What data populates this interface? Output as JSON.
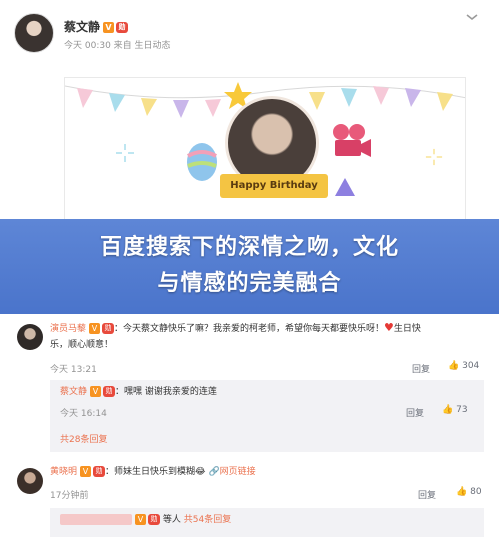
{
  "post": {
    "author": "蔡文静",
    "verified_badge": "V",
    "medal_badge": "勋",
    "meta": "今天 00:30 来自 生日动态",
    "more_icon": "chevron-down-icon",
    "card_caption": "Happy Birthday"
  },
  "banner": {
    "line1": "百度搜索下的深情之吻，文化",
    "line2": "与情感的完美融合"
  },
  "comments": [
    {
      "author": "演员马藜",
      "text_prefix": "：今天蔡文静快乐了嘛？我亲爱的柯老师，希望你每天都要快乐呀！",
      "text_suffix": "生日快",
      "text_line2": "乐，顺心顺意！",
      "time": "今天 13:21",
      "reply_label": "回复",
      "like_count": "304",
      "replies": [
        {
          "author": "蔡文静",
          "text": "：嘿嘿 谢谢我亲爱的连莲",
          "time": "今天 16:14",
          "reply_label": "回复",
          "like_count": "73"
        }
      ],
      "more_replies": "共28条回复"
    },
    {
      "author": "黄晓明",
      "text": "：师妹生日快乐到模糊",
      "web_link": "网页链接",
      "time": "17分钟前",
      "reply_label": "回复",
      "like_count": "80",
      "reply_preview_suffix": "等人",
      "reply_preview_count": "共54条回复"
    }
  ],
  "colors": {
    "banner": "#4a74cb",
    "username": "#eb7350",
    "meta_gray": "#939393"
  }
}
